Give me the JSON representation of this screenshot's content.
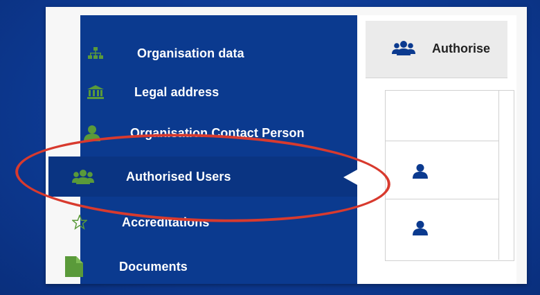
{
  "sidebar": {
    "items": [
      {
        "label": "Organisation data",
        "icon": "sitemap-icon"
      },
      {
        "label": "Legal address",
        "icon": "bank-icon"
      },
      {
        "label": "Organisation Contact Person",
        "icon": "user-icon"
      },
      {
        "label": "Authorised Users",
        "icon": "users-icon",
        "active": true
      },
      {
        "label": "Accreditations",
        "icon": "star-outline-icon"
      },
      {
        "label": "Documents",
        "icon": "file-icon"
      }
    ]
  },
  "main": {
    "tab_label": "Authorise",
    "rows": [
      {
        "icon": "user-icon"
      },
      {
        "icon": "user-icon"
      }
    ]
  },
  "colors": {
    "background": "#0d3a93",
    "sidebar": "#0b3a8f",
    "icon_green": "#5a9a3a",
    "row_icon": "#0b3a8f",
    "highlight": "#d83a2e"
  }
}
